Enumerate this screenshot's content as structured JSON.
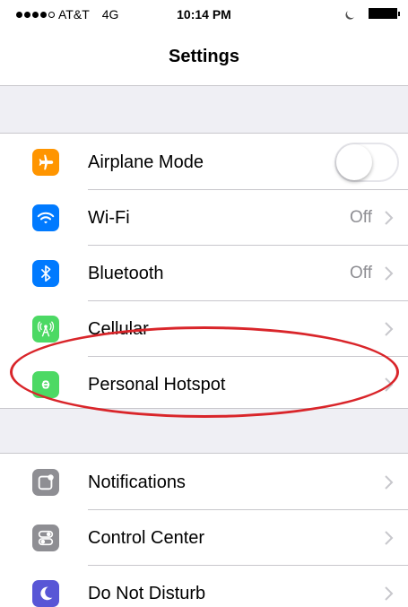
{
  "status_bar": {
    "signal_bars": 5,
    "signal_filled": 4,
    "carrier": "AT&T",
    "network": "4G",
    "time": "10:14 PM"
  },
  "nav": {
    "title": "Settings"
  },
  "group1": [
    {
      "label": "Airplane Mode",
      "icon": "airplane-icon",
      "color": "#ff9500",
      "toggle": "off"
    },
    {
      "label": "Wi-Fi",
      "icon": "wifi-icon",
      "color": "#007aff",
      "value": "Off"
    },
    {
      "label": "Bluetooth",
      "icon": "bluetooth-icon",
      "color": "#007aff",
      "value": "Off"
    },
    {
      "label": "Cellular",
      "icon": "cellular-icon",
      "color": "#4cd964"
    },
    {
      "label": "Personal Hotspot",
      "icon": "hotspot-icon",
      "color": "#4cd964"
    }
  ],
  "group2": [
    {
      "label": "Notifications",
      "icon": "notifications-icon",
      "color": "#8e8e93"
    },
    {
      "label": "Control Center",
      "icon": "control-center-icon",
      "color": "#8e8e93"
    },
    {
      "label": "Do Not Disturb",
      "icon": "moon-icon",
      "color": "#5856d6"
    }
  ],
  "annotation": {
    "highlight_color": "#d9252a",
    "target": "Personal Hotspot"
  }
}
